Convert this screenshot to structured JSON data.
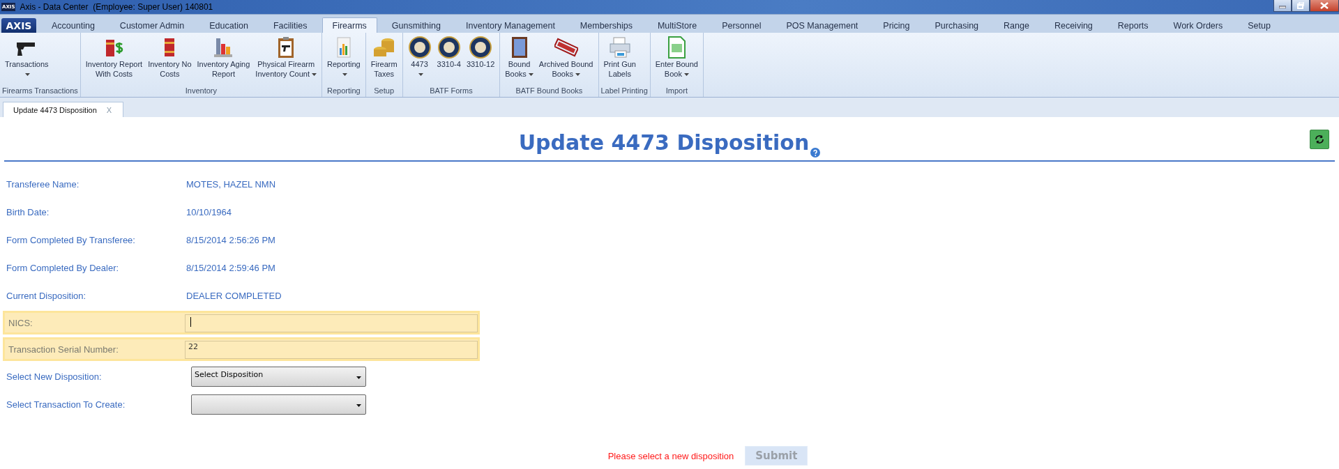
{
  "window": {
    "logo": "AXIS",
    "title": "Axis - Data Center  (Employee: Super User) 140801"
  },
  "menu": {
    "logo": "AXIS",
    "tabs": [
      {
        "label": "Accounting",
        "selected": false
      },
      {
        "label": "Customer Admin",
        "selected": false
      },
      {
        "label": "Education",
        "selected": false
      },
      {
        "label": "Facilities",
        "selected": false
      },
      {
        "label": "Firearms",
        "selected": true
      },
      {
        "label": "Gunsmithing",
        "selected": false
      },
      {
        "label": "Inventory Management",
        "selected": false
      },
      {
        "label": "Memberships",
        "selected": false
      },
      {
        "label": "MultiStore",
        "selected": false
      },
      {
        "label": "Personnel",
        "selected": false
      },
      {
        "label": "POS Management",
        "selected": false
      },
      {
        "label": "Pricing",
        "selected": false
      },
      {
        "label": "Purchasing",
        "selected": false
      },
      {
        "label": "Range",
        "selected": false
      },
      {
        "label": "Receiving",
        "selected": false
      },
      {
        "label": "Reports",
        "selected": false
      },
      {
        "label": "Work Orders",
        "selected": false
      },
      {
        "label": "Setup",
        "selected": false
      }
    ]
  },
  "ribbon": [
    {
      "name": "Firearms Transactions",
      "items": [
        {
          "kind": "pistol",
          "label": "Transactions",
          "dropdown": true
        }
      ]
    },
    {
      "name": "Inventory",
      "items": [
        {
          "kind": "books-dollar",
          "label": "Inventory Report\nWith Costs",
          "dropdown": false
        },
        {
          "kind": "book",
          "label": "Inventory No\nCosts",
          "dropdown": false
        },
        {
          "kind": "bar-chart",
          "label": "Inventory Aging\nReport",
          "dropdown": false
        },
        {
          "kind": "clipboard",
          "label": "Physical Firearm\nInventory Count",
          "dropdown": true
        }
      ]
    },
    {
      "name": "Reporting",
      "items": [
        {
          "kind": "report",
          "label": "Reporting",
          "dropdown": true
        }
      ]
    },
    {
      "name": "Setup",
      "items": [
        {
          "kind": "coins",
          "label": "Firearm\nTaxes",
          "dropdown": false
        }
      ]
    },
    {
      "name": "BATF Forms",
      "items": [
        {
          "kind": "seal",
          "label": "4473",
          "dropdown": true
        },
        {
          "kind": "seal",
          "label": "3310-4",
          "dropdown": false
        },
        {
          "kind": "seal",
          "label": "3310-12",
          "dropdown": false
        }
      ]
    },
    {
      "name": "BATF Bound Books",
      "items": [
        {
          "kind": "atf-book",
          "label": "Bound\nBooks",
          "dropdown": true
        },
        {
          "kind": "stamp",
          "label": "Archived Bound\nBooks",
          "dropdown": true
        }
      ]
    },
    {
      "name": "Label Printing",
      "items": [
        {
          "kind": "printer",
          "label": "Print Gun\nLabels",
          "dropdown": false
        }
      ]
    },
    {
      "name": "Import",
      "items": [
        {
          "kind": "spreadsheet",
          "label": "Enter Bound\nBook",
          "dropdown": true
        }
      ]
    }
  ],
  "document_tabs": [
    {
      "label": "Update 4473 Disposition",
      "close": "X",
      "selected": true
    }
  ],
  "page": {
    "title": "Update 4473 Disposition",
    "rows": [
      {
        "kind": "text",
        "label": "Transferee Name:",
        "value": "MOTES, HAZEL NMN"
      },
      {
        "kind": "text",
        "label": "Birth Date:",
        "value": "10/10/1964"
      },
      {
        "kind": "text",
        "label": "Form Completed By Transferee:",
        "value": "8/15/2014 2:56:26 PM"
      },
      {
        "kind": "text",
        "label": "Form Completed By Dealer:",
        "value": "8/15/2014 2:59:46 PM"
      },
      {
        "kind": "text",
        "label": "Current Disposition:",
        "value": "DEALER COMPLETED"
      },
      {
        "kind": "input",
        "label": "NICS:",
        "highlighted": true,
        "focused": true
      },
      {
        "kind": "input",
        "label": "Transaction Serial Number:",
        "value": "22",
        "highlighted": true,
        "focused": false
      },
      {
        "kind": "select",
        "label": "Select New Disposition:",
        "value": "Select Disposition"
      },
      {
        "kind": "select",
        "label": "Select Transaction To Create:"
      }
    ],
    "error": "Please select a new disposition",
    "submit": {
      "label": "Submit",
      "disabled": true
    }
  }
}
